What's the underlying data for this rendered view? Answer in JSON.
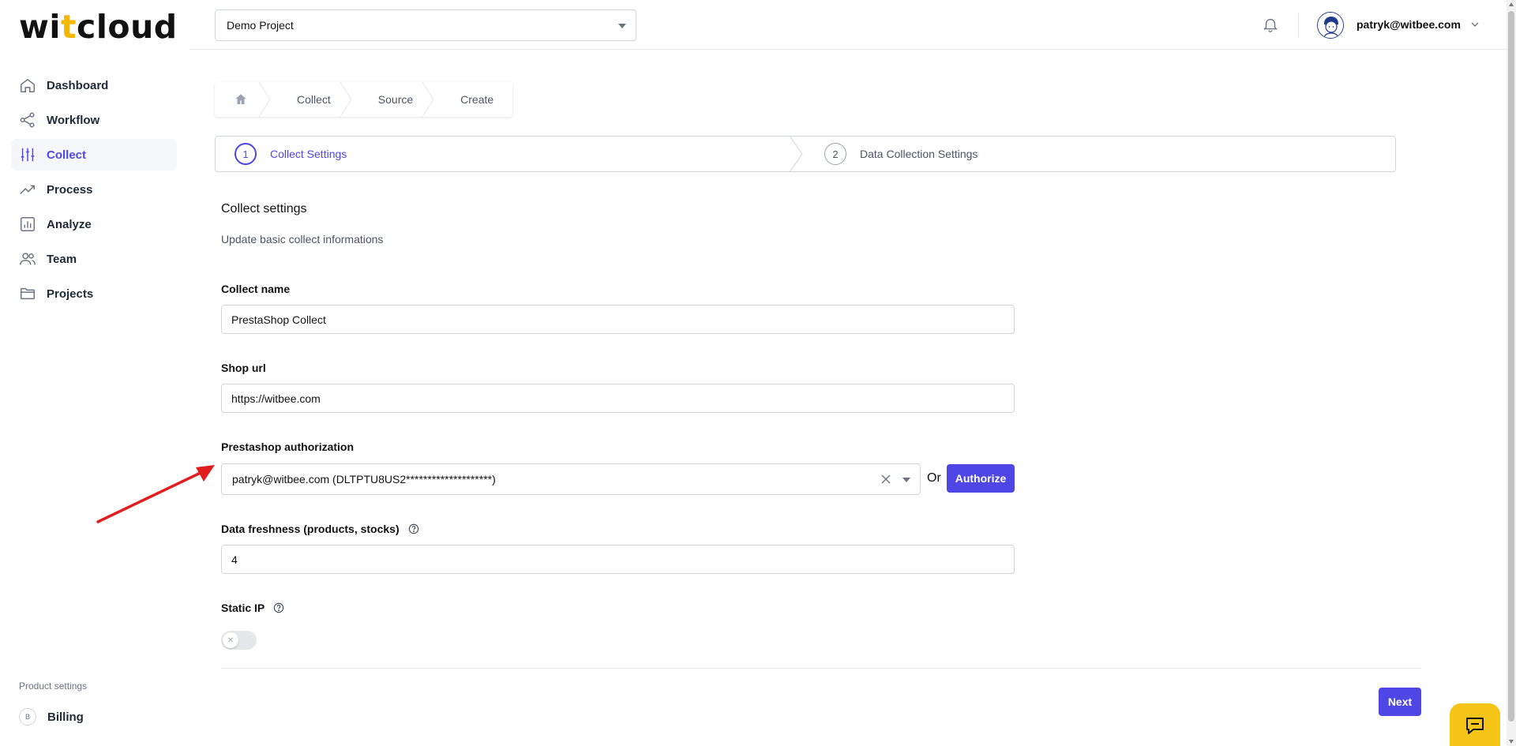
{
  "brand": {
    "logo_before": "wi",
    "logo_accent": "t",
    "logo_after": "cloud"
  },
  "sidebar": {
    "items": [
      {
        "label": "Dashboard",
        "icon": "home-icon",
        "active": false
      },
      {
        "label": "Workflow",
        "icon": "share-icon",
        "active": false
      },
      {
        "label": "Collect",
        "icon": "sliders-icon",
        "active": true
      },
      {
        "label": "Process",
        "icon": "trending-up-icon",
        "active": false
      },
      {
        "label": "Analyze",
        "icon": "bar-chart-icon",
        "active": false
      },
      {
        "label": "Team",
        "icon": "users-icon",
        "active": false
      },
      {
        "label": "Projects",
        "icon": "folder-icon",
        "active": false
      }
    ],
    "product_settings_label": "Product settings",
    "billing_badge": "B",
    "billing_label": "Billing"
  },
  "topbar": {
    "project": "Demo Project",
    "user_email": "patryk@witbee.com"
  },
  "breadcrumb": [
    "Collect",
    "Source",
    "Create"
  ],
  "steps": [
    {
      "num": "1",
      "label": "Collect Settings",
      "active": true
    },
    {
      "num": "2",
      "label": "Data Collection Settings",
      "active": false
    }
  ],
  "form": {
    "title": "Collect settings",
    "subtitle": "Update basic collect informations",
    "collect_name_label": "Collect name",
    "collect_name_value": "PrestaShop Collect",
    "shop_url_label": "Shop url",
    "shop_url_value": "https://witbee.com",
    "auth_label": "Prestashop authorization",
    "auth_value": "patryk@witbee.com (DLTPTU8US2********************)",
    "or_text": "Or",
    "authorize_label": "Authorize",
    "freshness_label": "Data freshness (products, stocks)",
    "freshness_value": "4",
    "static_ip_label": "Static IP",
    "static_ip_on": false,
    "next_label": "Next"
  },
  "colors": {
    "accent": "#4f46e5",
    "chat": "#f5c518",
    "arrow": "#e11d1d"
  }
}
